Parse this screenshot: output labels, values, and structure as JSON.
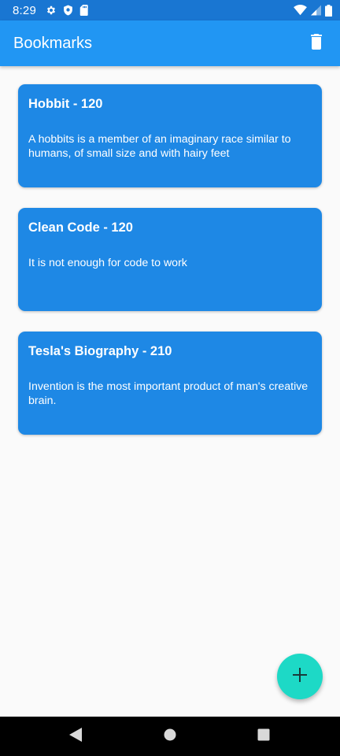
{
  "status_bar": {
    "time": "8:29",
    "icons_left": [
      "gear-icon",
      "shield-icon",
      "sd-card-icon"
    ],
    "icons_right": [
      "wifi-icon",
      "cell-signal-icon",
      "battery-icon"
    ]
  },
  "app_bar": {
    "title": "Bookmarks",
    "action_icon": "delete-icon"
  },
  "bookmarks": [
    {
      "title": "Hobbit - 120",
      "description": "A hobbits is a member of an imaginary race similar to humans, of small size and with hairy feet"
    },
    {
      "title": "Clean Code - 120",
      "description": "It is not enough for code to work"
    },
    {
      "title": "Tesla's Biography - 210",
      "description": "Invention is the most important product of man's creative brain."
    }
  ],
  "fab": {
    "icon": "add-icon"
  },
  "nav_bar": {
    "buttons": [
      "back-icon",
      "home-icon",
      "recents-icon"
    ]
  },
  "colors": {
    "status_bar": "#1976d2",
    "app_bar": "#2196f3",
    "card": "#1e88e5",
    "fab": "#1dd9c6",
    "background": "#fafafa",
    "nav_bar": "#000000"
  }
}
